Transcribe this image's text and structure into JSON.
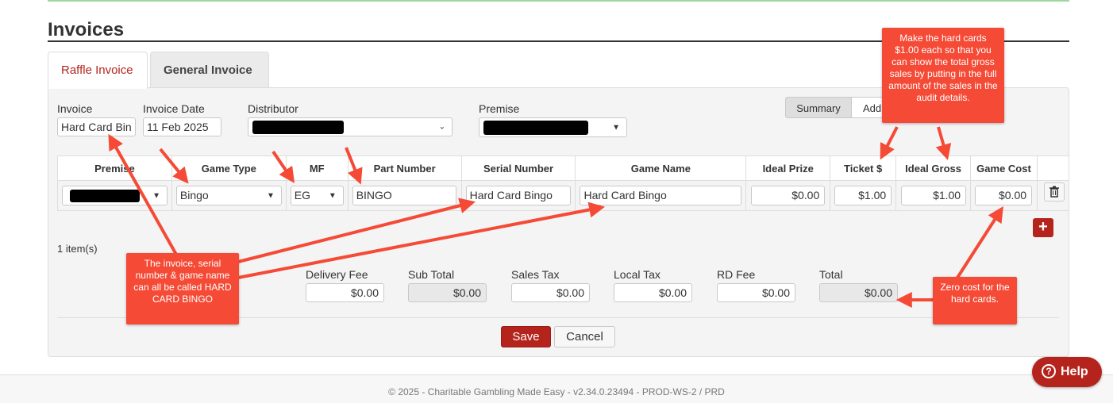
{
  "page": {
    "title": "Invoices"
  },
  "tabs": [
    {
      "label": "Raffle Invoice"
    },
    {
      "label": "General Invoice"
    }
  ],
  "form": {
    "invoice_label": "Invoice",
    "invoice_value": "Hard Card Bin",
    "date_label": "Invoice Date",
    "date_value": "11 Feb 2025",
    "distributor_label": "Distributor",
    "premise_label": "Premise"
  },
  "view_toggle": {
    "summary": "Summary",
    "add": "Add"
  },
  "table": {
    "headers": [
      "Premise",
      "Game Type",
      "MF",
      "Part Number",
      "Serial Number",
      "Game Name",
      "Ideal Prize",
      "Ticket $",
      "Ideal Gross",
      "Game Cost"
    ],
    "row": {
      "game_type": "Bingo",
      "mf": "EG",
      "part_number": "BINGO",
      "serial_number": "Hard Card Bingo",
      "game_name": "Hard Card Bingo",
      "ideal_prize": "$0.00",
      "ticket": "$1.00",
      "ideal_gross": "$1.00",
      "game_cost": "$0.00"
    }
  },
  "item_count": "1 item(s)",
  "totals": {
    "delivery_fee_label": "Delivery Fee",
    "delivery_fee": "$0.00",
    "sub_total_label": "Sub Total",
    "sub_total": "$0.00",
    "sales_tax_label": "Sales Tax",
    "sales_tax": "$0.00",
    "local_tax_label": "Local Tax",
    "local_tax": "$0.00",
    "rd_fee_label": "RD Fee",
    "rd_fee": "$0.00",
    "total_label": "Total",
    "total": "$0.00"
  },
  "buttons": {
    "save": "Save",
    "cancel": "Cancel",
    "help": "Help",
    "add_icon": "plus-icon",
    "delete_icon": "trash-icon"
  },
  "footer": "© 2025 - Charitable Gambling Made Easy - v2.34.0.23494 - PROD-WS-2 / PRD",
  "callouts": {
    "top": "Make the hard cards $1.00 each so that you can show the total gross sales by putting in the full amount of the sales in the audit details.",
    "left": "The invoice, serial number & game name can all be called HARD CARD BINGO",
    "right": "Zero cost for the hard cards."
  },
  "colors": {
    "accent": "#b5241c",
    "callout": "#f44a36",
    "top_rule": "#9fd89a"
  }
}
